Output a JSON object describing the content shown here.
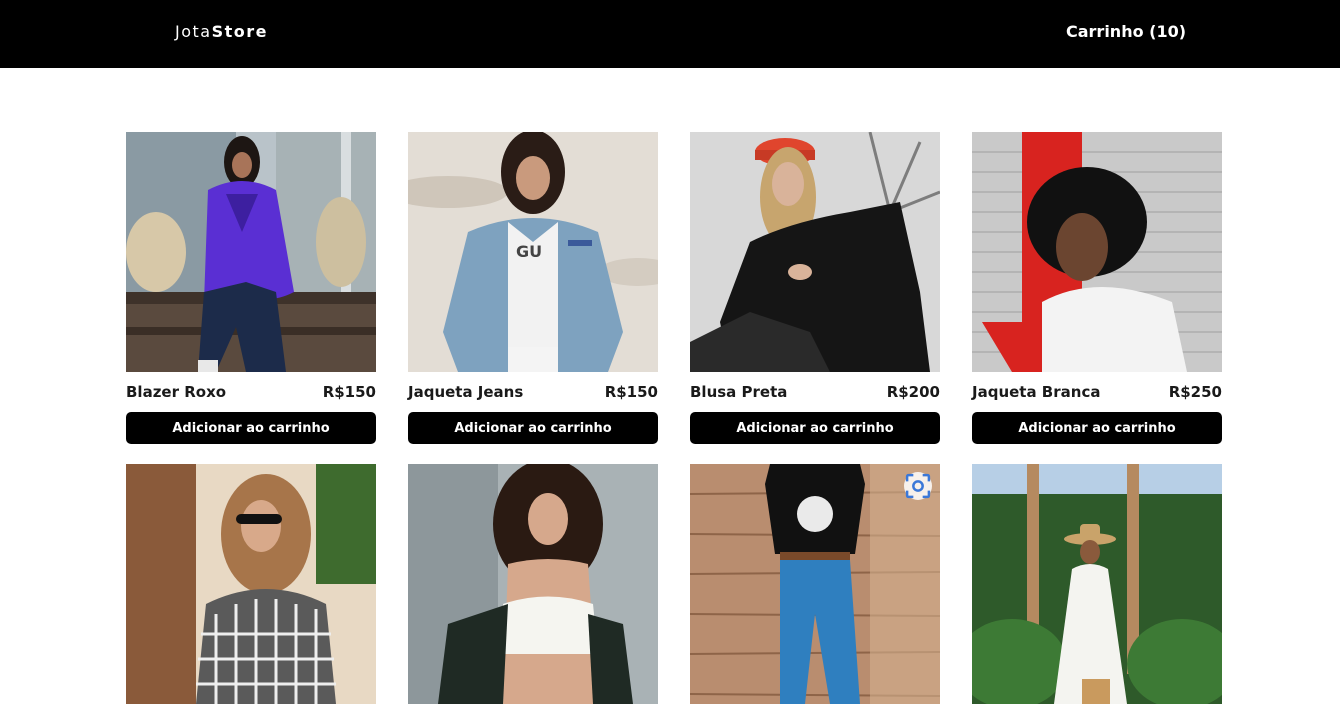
{
  "header": {
    "logo_light": "Jota",
    "logo_bold": "Store",
    "cart_label": "Carrinho (10)"
  },
  "products": [
    {
      "name": "Blazer Roxo",
      "price": "R$150",
      "button": "Adicionar ao carrinho"
    },
    {
      "name": "Jaqueta Jeans",
      "price": "R$150",
      "button": "Adicionar ao carrinho"
    },
    {
      "name": "Blusa Preta",
      "price": "R$200",
      "button": "Adicionar ao carrinho"
    },
    {
      "name": "Jaqueta Branca",
      "price": "R$250",
      "button": "Adicionar ao carrinho"
    }
  ],
  "colors": {
    "header_bg": "#000000",
    "button_bg": "#000000",
    "accent_blue": "#3b78d8"
  }
}
